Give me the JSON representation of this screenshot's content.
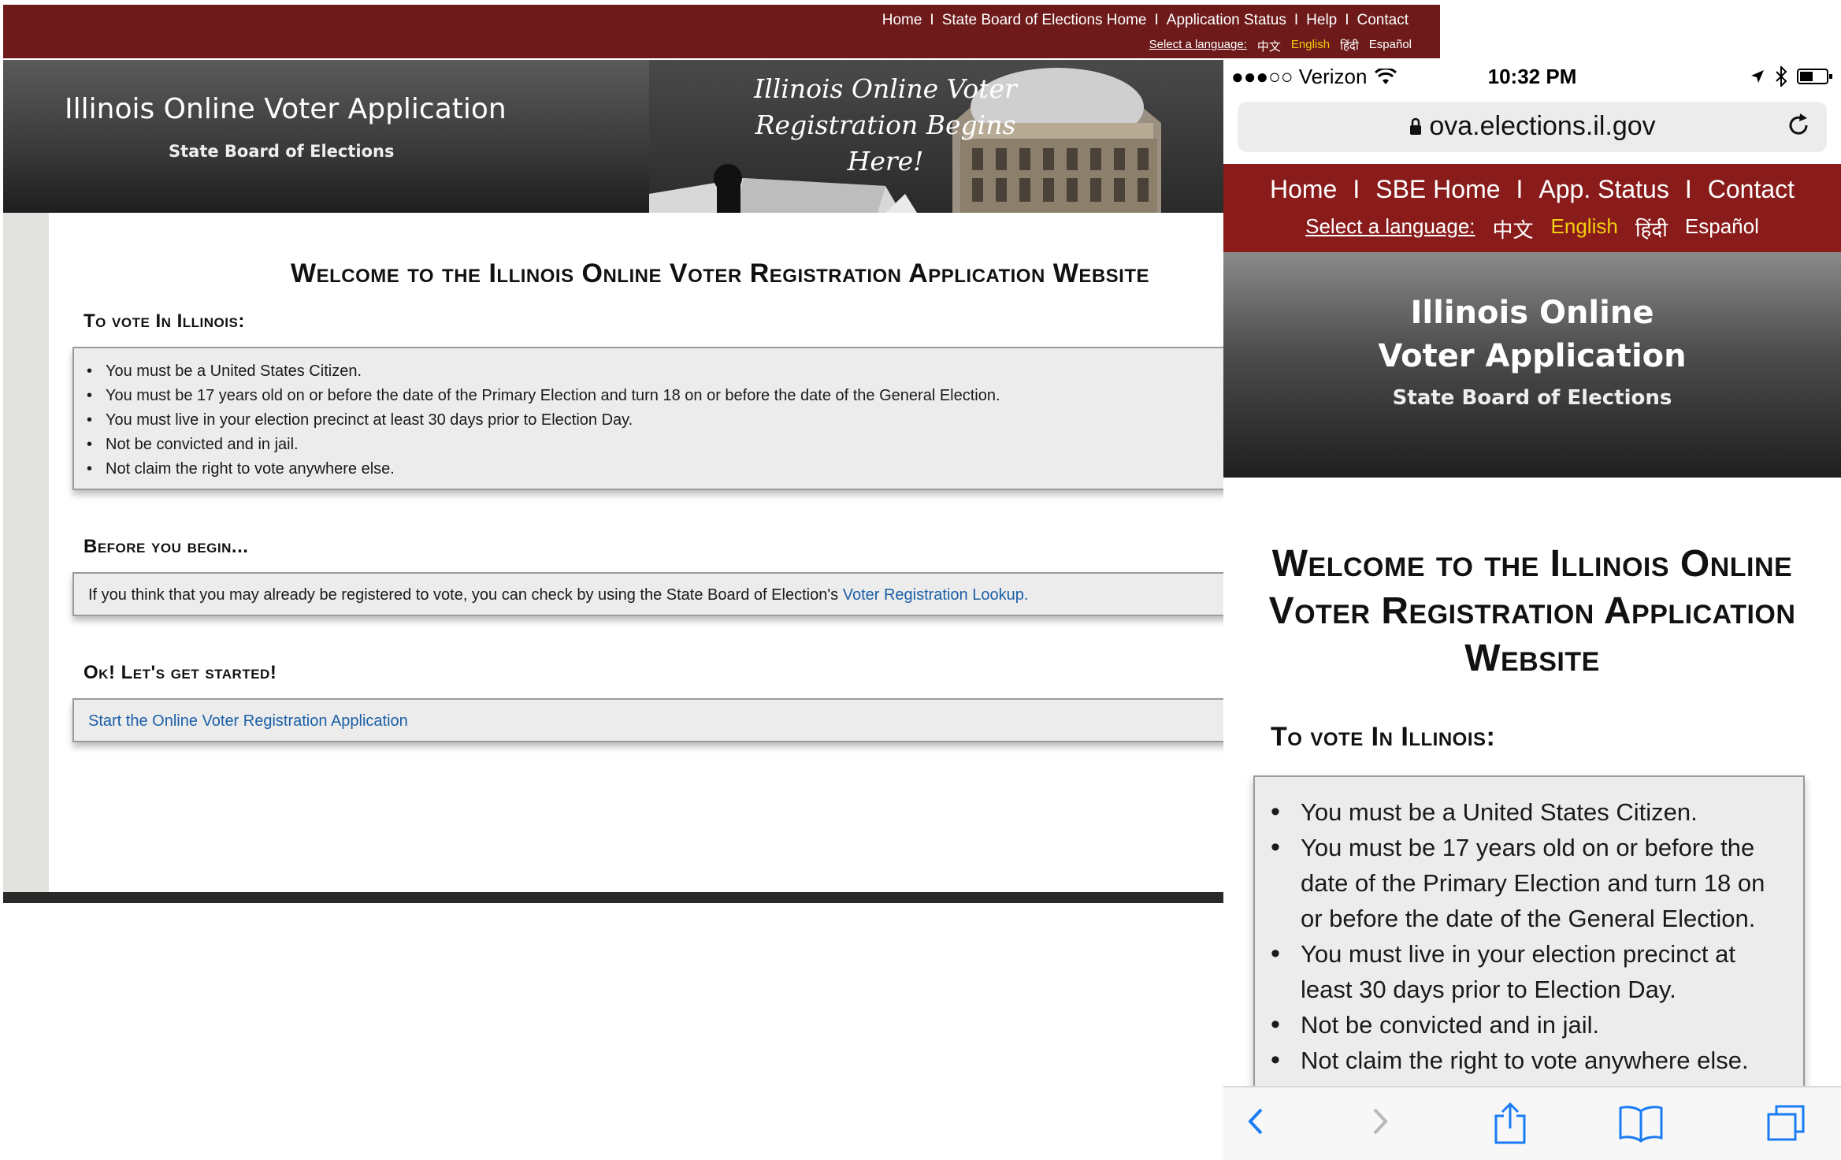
{
  "desktop": {
    "nav": [
      "Home",
      "State Board of Elections Home",
      "Application Status",
      "Help",
      "Contact"
    ],
    "nav_separator": "I",
    "language": {
      "label": "Select a language:",
      "options": [
        "中文",
        "English",
        "हिंदी",
        "Español"
      ],
      "active": "English"
    },
    "header": {
      "title": "Illinois Online Voter Application",
      "subtitle": "State Board of Elections",
      "slogan_line1": "Illinois Online Voter",
      "slogan_line2": "Registration Begins Here!"
    },
    "welcome_title": "Welcome to the Illinois Online Voter Registration Application Website",
    "to_vote": {
      "heading": "To vote In Illinois:",
      "items": [
        "You must be a United States Citizen.",
        "You must be 17 years old on or before the date of the Primary Election and turn 18 on or before the date of the General Election.",
        "You must live in your election precinct at least 30 days prior to Election Day.",
        "Not be convicted and in jail.",
        "Not claim the right to vote anywhere else."
      ]
    },
    "before": {
      "heading": "Before you begin...",
      "text": "If you think that you may already be registered to vote, you can check by using the State Board of Election's",
      "link": "Voter Registration Lookup."
    },
    "start": {
      "heading": "Ok! Let's get started!",
      "link": "Start the Online Voter Registration Application"
    }
  },
  "mobile": {
    "status": {
      "carrier": "●●●○○ Verizon",
      "time": "10:32 PM"
    },
    "url": "ova.elections.il.gov",
    "nav": [
      "Home",
      "SBE Home",
      "App. Status",
      "Contact"
    ],
    "nav_separator": "I",
    "language": {
      "label": "Select a language:",
      "options": [
        "中文",
        "English",
        "हिंदी",
        "Español"
      ],
      "active": "English"
    },
    "header": {
      "title_line1": "Illinois Online",
      "title_line2": "Voter Application",
      "subtitle": "State Board of Elections"
    },
    "welcome_title": "Welcome to the Illinois Online Voter Registration Application Website",
    "to_vote": {
      "heading": "To vote In Illinois:",
      "items": [
        "You must be a United States Citizen.",
        "You must be 17 years old on or before the date of the Primary Election and turn 18 on or before the date of the General Election.",
        "You must live in your election precinct at least 30 days prior to Election Day.",
        "Not be convicted and in jail.",
        "Not claim the right to vote anywhere else."
      ]
    },
    "toolbar": [
      "back-icon",
      "forward-icon",
      "share-icon",
      "bookmarks-icon",
      "tabs-icon"
    ]
  },
  "colors": {
    "nav_red": "#6e1a1a",
    "mobile_nav_red": "#8a1b1b",
    "active_language": "#f2cf10",
    "link_blue": "#1a5fa8",
    "ios_blue": "#1a7cf5"
  }
}
